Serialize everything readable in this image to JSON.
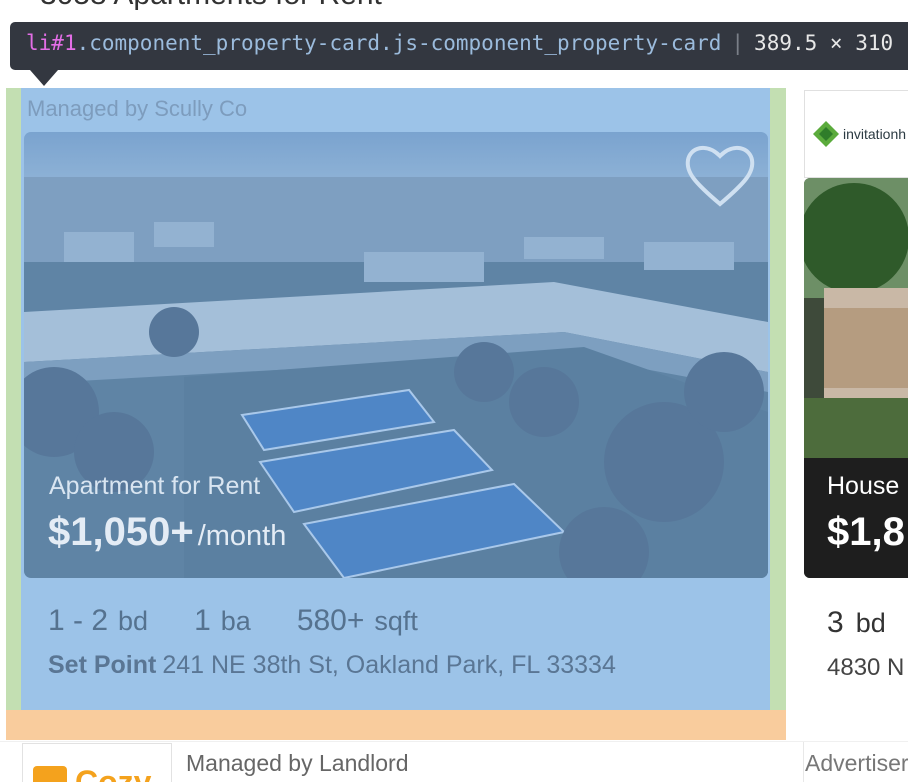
{
  "page": {
    "heading": "3058 Apartments for Rent"
  },
  "devtools": {
    "tag": "li",
    "id": "#1",
    "classes": ".component_property-card.js-component_property-card",
    "dims": "389.5 × 310"
  },
  "main_card": {
    "managed_by": "Managed by Scully Co",
    "type": "Apartment for Rent",
    "price": "$1,050+",
    "price_unit": "/month",
    "beds": "1 - 2",
    "beds_label": "bd",
    "baths": "1",
    "baths_label": "ba",
    "sqft": "580+",
    "sqft_label": "sqft",
    "complex": "Set Point",
    "address": "241 NE 38th St, Oakland Park, FL 33334",
    "favorite_icon": "heart-outline-icon"
  },
  "right_card": {
    "logo_text": "invitationh",
    "type": "House",
    "price": "$1,8",
    "beds": "3",
    "beds_label": "bd",
    "address": "4830 N"
  },
  "next_row": {
    "logo_text": "Cozy",
    "managed_by": "Managed by Landlord",
    "advert": "Advertiser"
  },
  "colors": {
    "content_overlay": "#9cc3e8",
    "padding_overlay": "#c3dfb2",
    "margin_overlay": "#f9cc9d",
    "tooltip_bg": "#333740"
  }
}
